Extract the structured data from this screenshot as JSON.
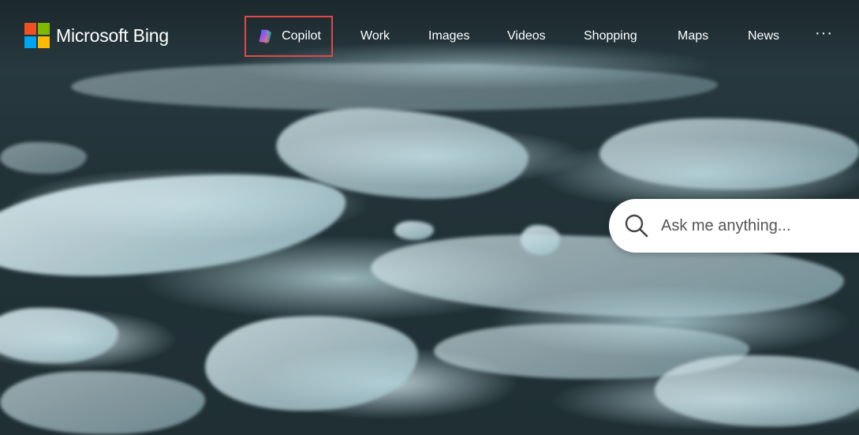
{
  "brand": {
    "name": "Microsoft Bing",
    "logo_colors": [
      "#f25022",
      "#7fba00",
      "#00a4ef",
      "#ffb900"
    ]
  },
  "nav": {
    "copilot": "Copilot",
    "work": "Work",
    "images": "Images",
    "videos": "Videos",
    "shopping": "Shopping",
    "maps": "Maps",
    "news": "News",
    "more": "···"
  },
  "search": {
    "placeholder": "Ask me anything..."
  },
  "highlight_color": "#e04848",
  "background": "ice-floes-photo"
}
